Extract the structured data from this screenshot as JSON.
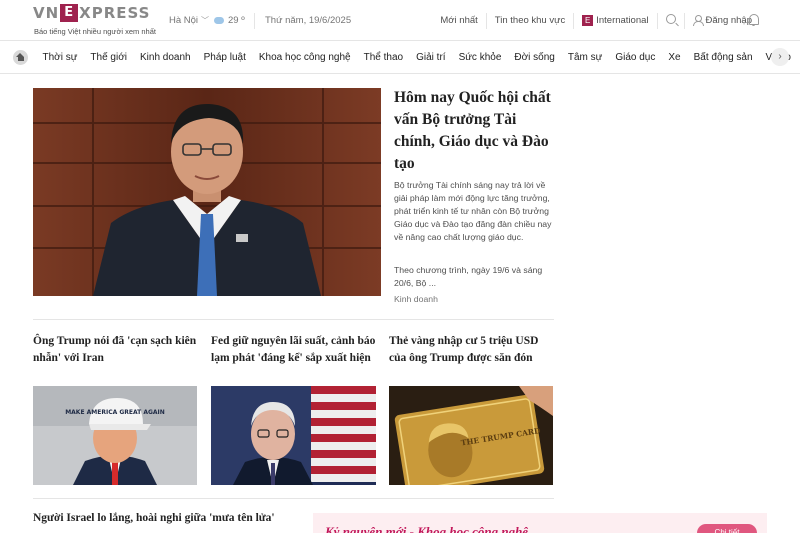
{
  "header": {
    "logo_left": "VN",
    "logo_e": "E",
    "logo_right": "XPRESS",
    "tagline": "Báo tiếng Việt nhiều người xem nhất",
    "location": "Hà Nội",
    "temperature": "29 º",
    "date": "Thứ năm, 19/6/2025",
    "links": {
      "latest": "Mới nhất",
      "local": "Tin theo khu vực",
      "intl_badge": "E",
      "international": "International",
      "login": "Đăng nhập"
    }
  },
  "nav": {
    "categories": [
      "Thời sự",
      "Thế giới",
      "Kinh doanh",
      "Pháp luật",
      "Khoa học công nghệ",
      "Thể thao",
      "Giải trí",
      "Sức khỏe",
      "Đời sống",
      "Tâm sự",
      "Giáo dục",
      "Xe",
      "Bất động sản",
      "Video"
    ],
    "next": "›"
  },
  "hero": {
    "title": "Hôm nay Quốc hội chất vấn Bộ trưởng Tài chính, Giáo dục và Đào tạo",
    "description": "Bộ trưởng Tài chính sáng nay trả lời về giải pháp làm mới động lực tăng trưởng, phát triển kinh tế tư nhân còn Bộ trưởng Giáo dục và Đào tạo đăng đàn chiều nay về nâng cao chất lượng giáo dục.",
    "extra": "Theo chương trình, ngày 19/6 và sáng 20/6, Bộ ...",
    "category": "Kinh doanh"
  },
  "cards": [
    {
      "title": "Ông Trump nói đã 'cạn sạch kiên nhẫn' với Iran",
      "cap_text": "MAKE AMERICA GREAT AGAIN"
    },
    {
      "title": "Fed giữ nguyên lãi suất, cảnh báo lạm phát 'đáng kể' sắp xuất hiện"
    },
    {
      "title": "Thẻ vàng nhập cư 5 triệu USD của ông Trump được săn đón",
      "card_text": "THE TRUMP CARD"
    }
  ],
  "bottom": {
    "title": "Người Israel lo lắng, hoài nghi giữa 'mưa tên lửa'",
    "banner_text": "Kỷ nguyên mới - Khoa học công nghệ",
    "banner_button": "Chi tiết"
  },
  "colors": {
    "brand": "#9f224e",
    "banner_bg": "#fdeef1",
    "banner_button": "#e0577f"
  }
}
